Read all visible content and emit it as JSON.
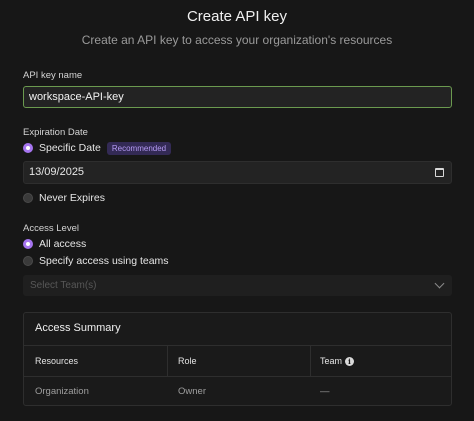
{
  "header": {
    "title": "Create API key",
    "subtitle": "Create an API key to access your organization's resources"
  },
  "name_field": {
    "label": "API key name",
    "value": "workspace-API-key"
  },
  "expiration": {
    "label": "Expiration Date",
    "options": [
      {
        "label": "Specific Date",
        "selected": true,
        "badge": "Recommended"
      },
      {
        "label": "Never Expires",
        "selected": false
      }
    ],
    "date_value": "13/09/2025"
  },
  "access": {
    "label": "Access Level",
    "options": [
      {
        "label": "All access",
        "selected": true
      },
      {
        "label": "Specify access using teams",
        "selected": false
      }
    ],
    "team_select_placeholder": "Select Team(s)"
  },
  "summary": {
    "title": "Access Summary",
    "columns": [
      "Resources",
      "Role",
      "Team"
    ],
    "rows": [
      {
        "resource": "Organization",
        "role": "Owner",
        "team": "—"
      }
    ]
  },
  "colors": {
    "accent": "#a675f0",
    "input_focus_border": "#6b9a4f",
    "badge_bg": "#332a55",
    "background": "#171717"
  }
}
